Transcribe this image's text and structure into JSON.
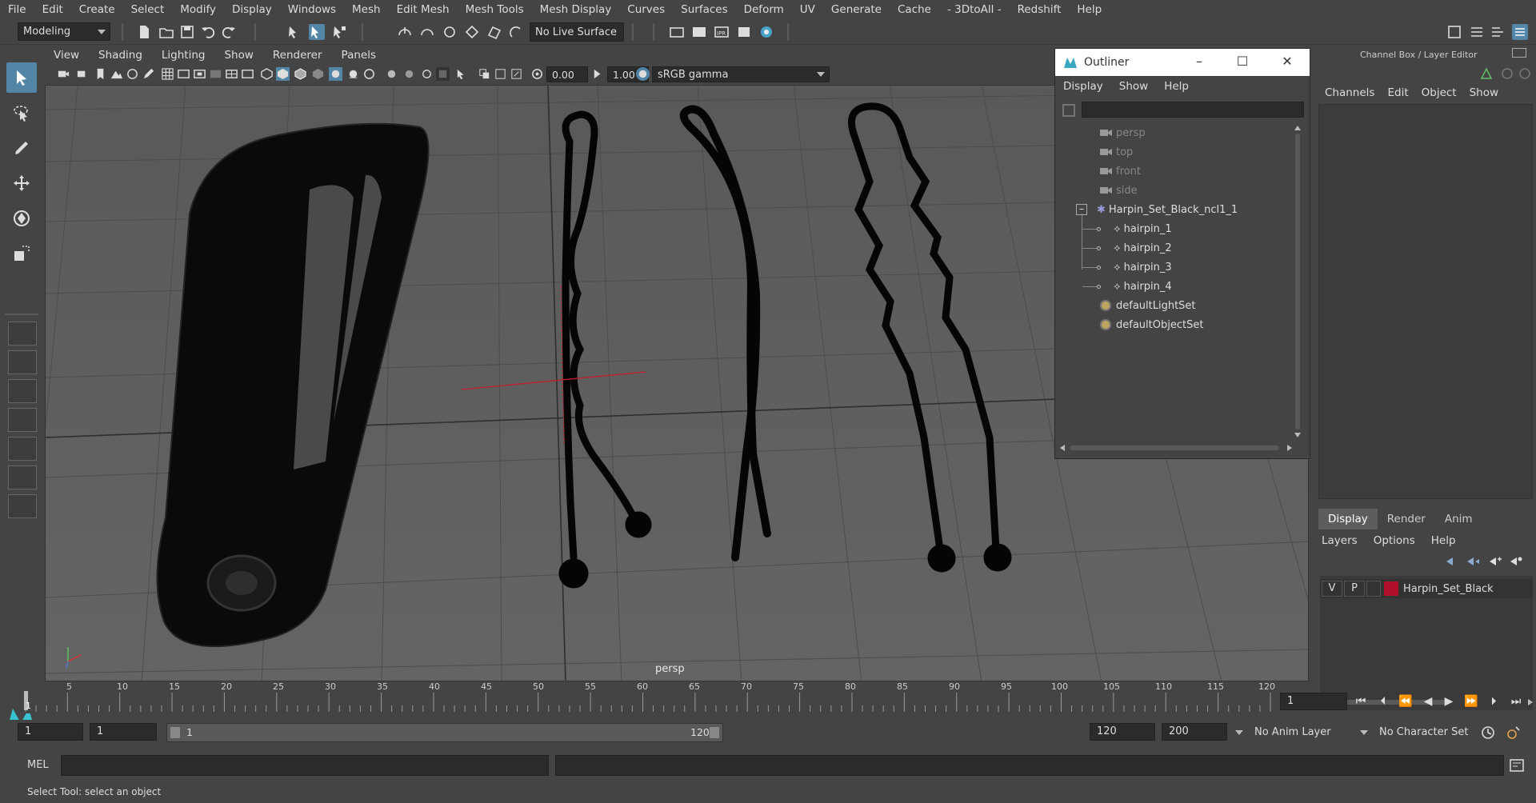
{
  "menubar": {
    "items": [
      "File",
      "Edit",
      "Create",
      "Select",
      "Modify",
      "Display",
      "Windows",
      "Mesh",
      "Edit Mesh",
      "Mesh Tools",
      "Mesh Display",
      "Curves",
      "Surfaces",
      "Deform",
      "UV",
      "Generate",
      "Cache",
      "- 3DtoAll -",
      "Redshift",
      "Help"
    ]
  },
  "statusline": {
    "mode": "Modeling",
    "live_surface": "No Live Surface"
  },
  "panel": {
    "menu": [
      "View",
      "Shading",
      "Lighting",
      "Show",
      "Renderer",
      "Panels"
    ],
    "exposure": "0.00",
    "gamma_value": "1.00",
    "color_space": "sRGB gamma",
    "camera_label": "persp"
  },
  "outliner": {
    "title": "Outliner",
    "menu": [
      "Display",
      "Show",
      "Help"
    ],
    "items": [
      {
        "label": "persp",
        "dim": true
      },
      {
        "label": "top",
        "dim": true
      },
      {
        "label": "front",
        "dim": true
      },
      {
        "label": "side",
        "dim": true
      },
      {
        "label": "Harpin_Set_Black_ncl1_1",
        "dim": false
      },
      {
        "label": "hairpin_1",
        "dim": false
      },
      {
        "label": "hairpin_2",
        "dim": false
      },
      {
        "label": "hairpin_3",
        "dim": false
      },
      {
        "label": "hairpin_4",
        "dim": false
      },
      {
        "label": "defaultLightSet",
        "dim": false
      },
      {
        "label": "defaultObjectSet",
        "dim": false
      }
    ]
  },
  "channelbox": {
    "title": "Channel Box / Layer Editor",
    "menu": [
      "Channels",
      "Edit",
      "Object",
      "Show"
    ],
    "tabs": [
      "Display",
      "Render",
      "Anim"
    ],
    "layer_menu": [
      "Layers",
      "Options",
      "Help"
    ],
    "layer": {
      "v": "V",
      "p": "P",
      "name": "Harpin_Set_Black",
      "color": "#b0102a"
    }
  },
  "timeline": {
    "ticks": [
      "5",
      "10",
      "15",
      "20",
      "25",
      "30",
      "35",
      "40",
      "45",
      "50",
      "55",
      "60",
      "65",
      "70",
      "75",
      "80",
      "85",
      "90",
      "95",
      "100",
      "105",
      "110",
      "115",
      "120"
    ],
    "current_frame": "1",
    "start_marker": "1"
  },
  "range": {
    "start": "1",
    "anim_start": "1",
    "range_start": "1",
    "range_end": "120",
    "end": "120",
    "anim_end": "200",
    "anim_layer": "No Anim Layer",
    "char_set": "No Character Set"
  },
  "cmdline": {
    "label": "MEL",
    "help": "Select Tool: select an object"
  },
  "colors": {
    "accent": "#5285a6",
    "viewport_bg": "#5e5e5e"
  }
}
